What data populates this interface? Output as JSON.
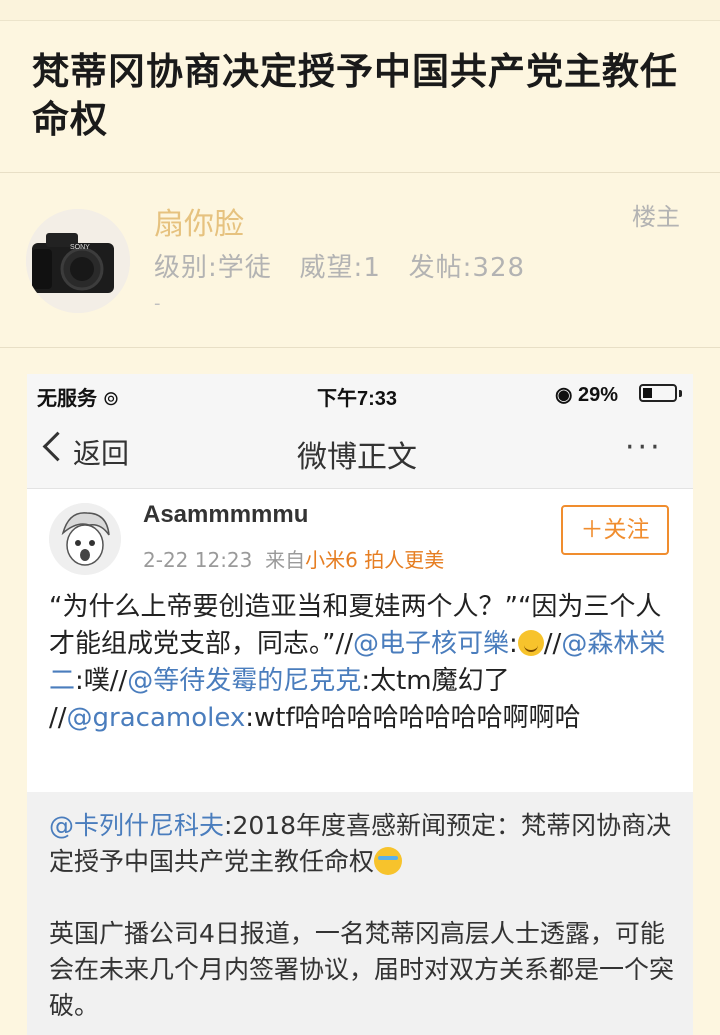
{
  "thread": {
    "title": "梵蒂冈协商决定授予中国共产党主教任命权"
  },
  "author": {
    "name": "扇你脸",
    "meta": "级别:学徒   威望:1   发帖:328",
    "dash": "-",
    "badge": "楼主"
  },
  "screenshot": {
    "status": {
      "carrier": "无服务",
      "time": "下午7:33",
      "battery": "29%",
      "battery_level": 0.29
    },
    "nav": {
      "back_label": "返回",
      "title": "微博正文",
      "more": "···"
    },
    "post": {
      "username": "Asammmmmu",
      "date": "2-22 12:23",
      "from_prefix": "来自",
      "source": "小米6 拍人更美",
      "follow_label": "＋关注",
      "text_1": "“为什么上帝要创造亚当和夏娃两个人？”“因为三个人才能组成党支部，同志。”//",
      "mention_1": "@电子核可樂",
      "text_2": ":",
      "text_3": "//",
      "mention_2": "@森林栄二",
      "text_4": ":噗//",
      "mention_3": "@等待发霉的尼克克",
      "text_5": ":太tm魔幻了 //",
      "mention_4": "@gracamolex",
      "text_6": ":wtf哈哈哈哈哈哈哈哈啊啊哈"
    },
    "repost": {
      "mention": "@卡列什尼科夫",
      "text_1": ":2018年度喜感新闻预定：梵蒂冈协商决定授予中国共产党主教任命权",
      "text_2": "英国广播公司4日报道，一名梵蒂冈高层人士透露，可能会在未来几个月内签署协议，届时对双方关系都是一个突破。"
    }
  },
  "colors": {
    "page_bg": "#fdf6e0",
    "username": "#e6c27f",
    "mention": "#4a7dbd",
    "follow": "#f08d2e"
  }
}
